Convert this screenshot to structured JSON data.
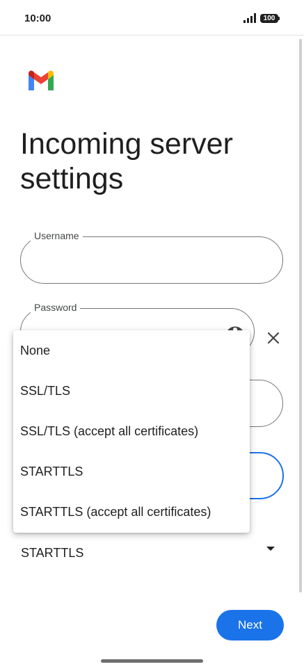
{
  "status_bar": {
    "time": "10:00",
    "battery": "100"
  },
  "app": {
    "logo": "gmail-logo"
  },
  "page": {
    "title": "Incoming server settings"
  },
  "form": {
    "username_label": "Username",
    "password_label": "Password",
    "username_value": "",
    "password_value": "",
    "security_type_value": "STARTTLS"
  },
  "security_menu": {
    "options": [
      "None",
      "SSL/TLS",
      "SSL/TLS (accept all certificates)",
      "STARTTLS",
      "STARTTLS (accept all certificates)"
    ]
  },
  "actions": {
    "next_label": "Next"
  },
  "colors": {
    "accent": "#1a73e8",
    "outline": "#747775",
    "text": "#1f1f1f"
  }
}
